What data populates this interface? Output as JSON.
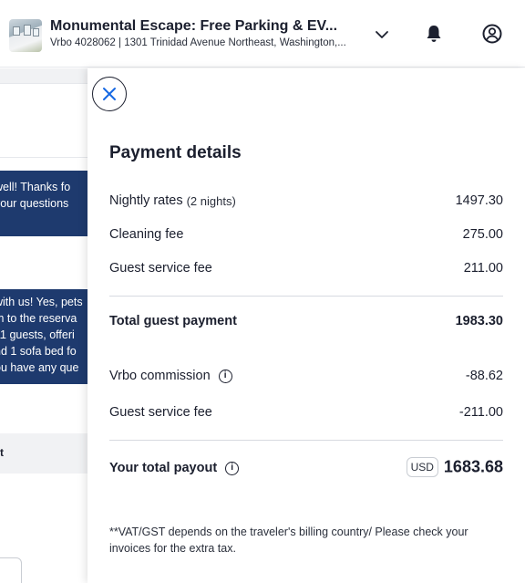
{
  "header": {
    "title": "Monumental Escape: Free Parking & EV...",
    "subtitle": "Vrbo 4028062 | 1301 Trinidad Avenue Northeast, Washington,...",
    "icons": [
      "chevron-down-icon",
      "bell-icon",
      "account-icon"
    ]
  },
  "background_chat": {
    "message1": [
      "well! Thanks fo",
      "your questions"
    ],
    "message2": [
      "with us! Yes, pets",
      "m to the reserva",
      "11 guests, offeri",
      "nd 1 sofa bed fo",
      "ou have any que"
    ],
    "row_label": "t"
  },
  "payment": {
    "title": "Payment details",
    "rows": [
      {
        "label": "Nightly rates",
        "note": "(2 nights)",
        "value": "1497.30"
      },
      {
        "label": "Cleaning fee",
        "value": "275.00"
      },
      {
        "label": "Guest service fee",
        "value": "211.00"
      }
    ],
    "total": {
      "label": "Total guest payment",
      "value": "1983.30"
    },
    "deductions": [
      {
        "label": "Vrbo commission",
        "value": "-88.62",
        "icon": "info-icon"
      },
      {
        "label": "Guest service fee",
        "value": "-211.00"
      }
    ],
    "payout": {
      "label": "Your total payout",
      "currency": "USD",
      "value": "1683.68",
      "icon": "info-icon"
    },
    "footnote": "**VAT/GST depends on the traveler's billing country/ Please check your invoices for the extra tax."
  },
  "colors": {
    "text": "#1b1f2e",
    "message_bubble": "#1e3a6e",
    "close_icon": "#1668e3",
    "divider": "#d7dae0"
  }
}
